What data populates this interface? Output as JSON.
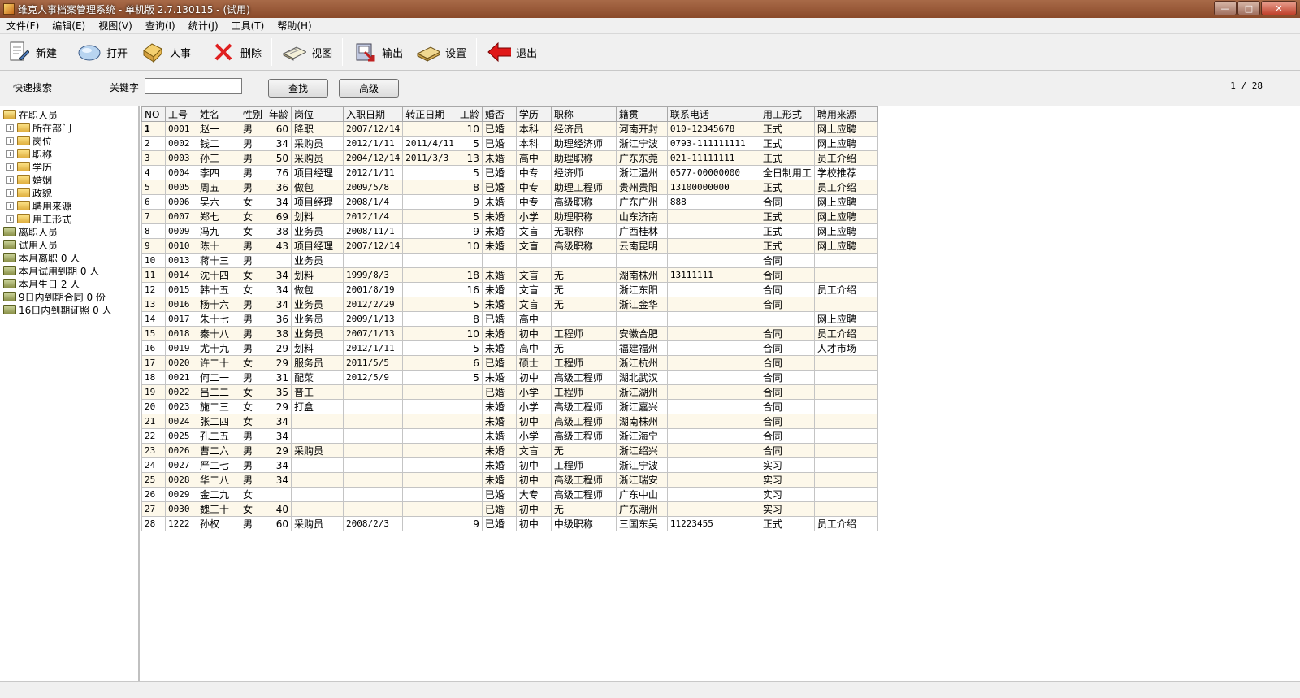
{
  "window": {
    "title": "维克人事档案管理系统 - 单机版 2.7.130115 - (试用)"
  },
  "menu": [
    "文件(F)",
    "编辑(E)",
    "视图(V)",
    "查询(I)",
    "统计(J)",
    "工具(T)",
    "帮助(H)"
  ],
  "toolbar": {
    "new": "新建",
    "open": "打开",
    "hr": "人事",
    "delete": "删除",
    "view": "视图",
    "export": "输出",
    "settings": "设置",
    "exit": "退出"
  },
  "search": {
    "title": "快速搜索",
    "keyword_label": "关键字",
    "keyword_value": "",
    "find_label": "查找",
    "advanced_label": "高级",
    "page_indicator": "1 / 28"
  },
  "tree": {
    "root": "在职人员",
    "children": [
      "所在部门",
      "岗位",
      "职称",
      "学历",
      "婚姻",
      "政貌",
      "聘用来源",
      "用工形式"
    ],
    "others": [
      "离职人员",
      "试用人员",
      "本月离职 0 人",
      "本月试用到期 0 人",
      "本月生日 2 人",
      "9日内到期合同 0 份",
      "16日内到期证照 0 人"
    ]
  },
  "table": {
    "headers": [
      "NO",
      "工号",
      "姓名",
      "性别",
      "年龄",
      "岗位",
      "入职日期",
      "转正日期",
      "工龄",
      "婚否",
      "学历",
      "职称",
      "籍贯",
      "联系电话",
      "用工形式",
      "聘用来源"
    ],
    "rows": [
      [
        "1",
        "0001",
        "赵一",
        "男",
        "60",
        "降职",
        "2007/12/14",
        "",
        "10",
        "已婚",
        "本科",
        "经济员",
        "河南开封",
        "010-12345678",
        "正式",
        "网上应聘"
      ],
      [
        "2",
        "0002",
        "钱二",
        "男",
        "34",
        "采购员",
        "2012/1/11",
        "2011/4/11",
        "5",
        "已婚",
        "本科",
        "助理经济师",
        "浙江宁波",
        "0793-111111111",
        "正式",
        "网上应聘"
      ],
      [
        "3",
        "0003",
        "孙三",
        "男",
        "50",
        "采购员",
        "2004/12/14",
        "2011/3/3",
        "13",
        "未婚",
        "高中",
        "助理职称",
        "广东东莞",
        "021-11111111",
        "正式",
        "员工介绍"
      ],
      [
        "4",
        "0004",
        "李四",
        "男",
        "76",
        "项目经理",
        "2012/1/11",
        "",
        "5",
        "已婚",
        "中专",
        "经济师",
        "浙江温州",
        "0577-00000000",
        "全日制用工",
        "学校推荐"
      ],
      [
        "5",
        "0005",
        "周五",
        "男",
        "36",
        "做包",
        "2009/5/8",
        "",
        "8",
        "已婚",
        "中专",
        "助理工程师",
        "贵州贵阳",
        "13100000000",
        "正式",
        "员工介绍"
      ],
      [
        "6",
        "0006",
        "吴六",
        "女",
        "34",
        "项目经理",
        "2008/1/4",
        "",
        "9",
        "未婚",
        "中专",
        "高级职称",
        "广东广州",
        "888",
        "合同",
        "网上应聘"
      ],
      [
        "7",
        "0007",
        "郑七",
        "女",
        "69",
        "划料",
        "2012/1/4",
        "",
        "5",
        "未婚",
        "小学",
        "助理职称",
        "山东济南",
        "",
        "正式",
        "网上应聘"
      ],
      [
        "8",
        "0009",
        "冯九",
        "女",
        "38",
        "业务员",
        "2008/11/1",
        "",
        "9",
        "未婚",
        "文盲",
        "无职称",
        "广西桂林",
        "",
        "正式",
        "网上应聘"
      ],
      [
        "9",
        "0010",
        "陈十",
        "男",
        "43",
        "项目经理",
        "2007/12/14",
        "",
        "10",
        "未婚",
        "文盲",
        "高级职称",
        "云南昆明",
        "",
        "正式",
        "网上应聘"
      ],
      [
        "10",
        "0013",
        "蒋十三",
        "男",
        "",
        "业务员",
        "",
        "",
        "",
        "",
        "",
        "",
        "",
        "",
        "合同",
        ""
      ],
      [
        "11",
        "0014",
        "沈十四",
        "女",
        "34",
        "划料",
        "1999/8/3",
        "",
        "18",
        "未婚",
        "文盲",
        "无",
        "湖南株州",
        "13111111",
        "合同",
        ""
      ],
      [
        "12",
        "0015",
        "韩十五",
        "女",
        "34",
        "做包",
        "2001/8/19",
        "",
        "16",
        "未婚",
        "文盲",
        "无",
        "浙江东阳",
        "",
        "合同",
        "员工介绍"
      ],
      [
        "13",
        "0016",
        "杨十六",
        "男",
        "34",
        "业务员",
        "2012/2/29",
        "",
        "5",
        "未婚",
        "文盲",
        "无",
        "浙江金华",
        "",
        "合同",
        ""
      ],
      [
        "14",
        "0017",
        "朱十七",
        "男",
        "36",
        "业务员",
        "2009/1/13",
        "",
        "8",
        "已婚",
        "高中",
        "",
        "",
        "",
        "",
        "网上应聘"
      ],
      [
        "15",
        "0018",
        "秦十八",
        "男",
        "38",
        "业务员",
        "2007/1/13",
        "",
        "10",
        "未婚",
        "初中",
        "工程师",
        "安徽合肥",
        "",
        "合同",
        "员工介绍"
      ],
      [
        "16",
        "0019",
        "尤十九",
        "男",
        "29",
        "划料",
        "2012/1/11",
        "",
        "5",
        "未婚",
        "高中",
        "无",
        "福建福州",
        "",
        "合同",
        "人才市场"
      ],
      [
        "17",
        "0020",
        "许二十",
        "女",
        "29",
        "服务员",
        "2011/5/5",
        "",
        "6",
        "已婚",
        "硕士",
        "工程师",
        "浙江杭州",
        "",
        "合同",
        ""
      ],
      [
        "18",
        "0021",
        "何二一",
        "男",
        "31",
        "配菜",
        "2012/5/9",
        "",
        "5",
        "未婚",
        "初中",
        "高级工程师",
        "湖北武汉",
        "",
        "合同",
        ""
      ],
      [
        "19",
        "0022",
        "吕二二",
        "女",
        "35",
        "普工",
        "",
        "",
        "",
        "已婚",
        "小学",
        "工程师",
        "浙江湖州",
        "",
        "合同",
        ""
      ],
      [
        "20",
        "0023",
        "施二三",
        "女",
        "29",
        "打盒",
        "",
        "",
        "",
        "未婚",
        "小学",
        "高级工程师",
        "浙江嘉兴",
        "",
        "合同",
        ""
      ],
      [
        "21",
        "0024",
        "张二四",
        "女",
        "34",
        "",
        "",
        "",
        "",
        "未婚",
        "初中",
        "高级工程师",
        "湖南株州",
        "",
        "合同",
        ""
      ],
      [
        "22",
        "0025",
        "孔二五",
        "男",
        "34",
        "",
        "",
        "",
        "",
        "未婚",
        "小学",
        "高级工程师",
        "浙江海宁",
        "",
        "合同",
        ""
      ],
      [
        "23",
        "0026",
        "曹二六",
        "男",
        "29",
        "采购员",
        "",
        "",
        "",
        "未婚",
        "文盲",
        "无",
        "浙江绍兴",
        "",
        "合同",
        ""
      ],
      [
        "24",
        "0027",
        "严二七",
        "男",
        "34",
        "",
        "",
        "",
        "",
        "未婚",
        "初中",
        "工程师",
        "浙江宁波",
        "",
        "实习",
        ""
      ],
      [
        "25",
        "0028",
        "华二八",
        "男",
        "34",
        "",
        "",
        "",
        "",
        "未婚",
        "初中",
        "高级工程师",
        "浙江瑞安",
        "",
        "实习",
        ""
      ],
      [
        "26",
        "0029",
        "金二九",
        "女",
        "",
        "",
        "",
        "",
        "",
        "已婚",
        "大专",
        "高级工程师",
        "广东中山",
        "",
        "实习",
        ""
      ],
      [
        "27",
        "0030",
        "魏三十",
        "女",
        "40",
        "",
        "",
        "",
        "",
        "已婚",
        "初中",
        "无",
        "广东潮州",
        "",
        "实习",
        ""
      ],
      [
        "28",
        "1222",
        "孙权",
        "男",
        "60",
        "采购员",
        "2008/2/3",
        "",
        "9",
        "已婚",
        "初中",
        "中级职称",
        "三国东吴",
        "11223455",
        "正式",
        "员工介绍"
      ]
    ]
  }
}
